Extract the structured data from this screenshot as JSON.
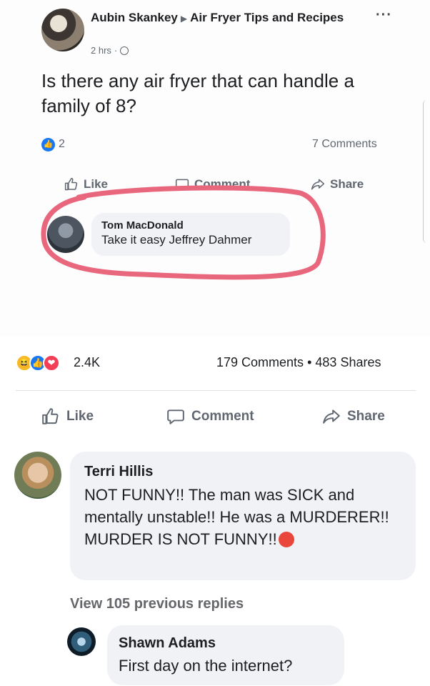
{
  "inner_post": {
    "author": "Aubin Skankey",
    "group": "Air Fryer Tips and Recipes",
    "time": "2 hrs",
    "more_label": "···",
    "text": "Is there any air fryer that can handle a family of 8?",
    "like_count": "2",
    "comments_count": "7 Comments",
    "actions": {
      "like": "Like",
      "comment": "Comment",
      "share": "Share"
    },
    "reply": {
      "name": "Tom MacDonald",
      "text": "Take it easy Jeffrey Dahmer"
    },
    "highlight_color": "#e8677d"
  },
  "outer_post": {
    "reaction_count": "2.4K",
    "reactions": [
      "haha",
      "like",
      "love"
    ],
    "comments": "179 Comments",
    "separator": "•",
    "shares": "483 Shares",
    "actions": {
      "like": "Like",
      "comment": "Comment",
      "share": "Share"
    }
  },
  "comments": [
    {
      "name": "Terri Hillis",
      "text": "NOT FUNNY!! The man was SICK and mentally unstable!! He was a MURDERER!! MURDER IS NOT FUNNY!!",
      "emoji": "angry-face-icon"
    }
  ],
  "view_previous": "View 105 previous replies",
  "reply": {
    "name": "Shawn Adams",
    "text": "First day on the internet?"
  }
}
